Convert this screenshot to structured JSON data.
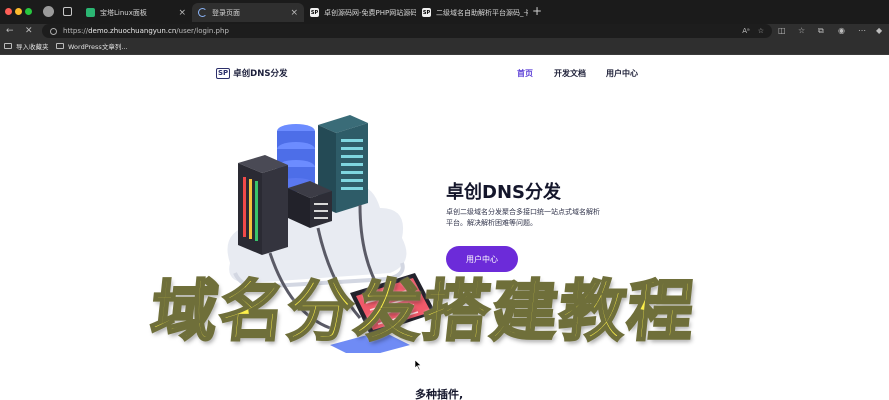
{
  "browser": {
    "tabs": [
      {
        "label": "宝塔Linux面板",
        "active": false
      },
      {
        "label": "登录页面",
        "active": true
      },
      {
        "label": "卓创源码网-免费PHP网站源码分",
        "active": false
      },
      {
        "label": "二级域名自助解析平台源码_卡密",
        "active": false
      }
    ],
    "url_scheme": "https://",
    "url_host": "demo.zhuochuangyun.cn",
    "url_path": "/user/login.php",
    "bookmarks": [
      {
        "label": "导入收藏夹"
      },
      {
        "label": "WordPress文章列..."
      }
    ]
  },
  "site": {
    "logo_badge": "SP",
    "logo_text": "卓创DNS分发",
    "nav": {
      "home": "首页",
      "dev_docs": "开发文档",
      "user_center": "用户中心"
    },
    "hero": {
      "title": "卓创DNS分发",
      "description": "卓创二级域名分发聚合多接口统一站点式域名解析平台。解决解析困难等问题。",
      "button": "用户中心"
    },
    "section_title": "多种插件,"
  },
  "overlay": {
    "text": "域名分发搭建教程"
  },
  "colors": {
    "accent": "#6c2bd9",
    "nav_active": "#5b3fd6",
    "overlay_fill": "#fdf04a"
  }
}
